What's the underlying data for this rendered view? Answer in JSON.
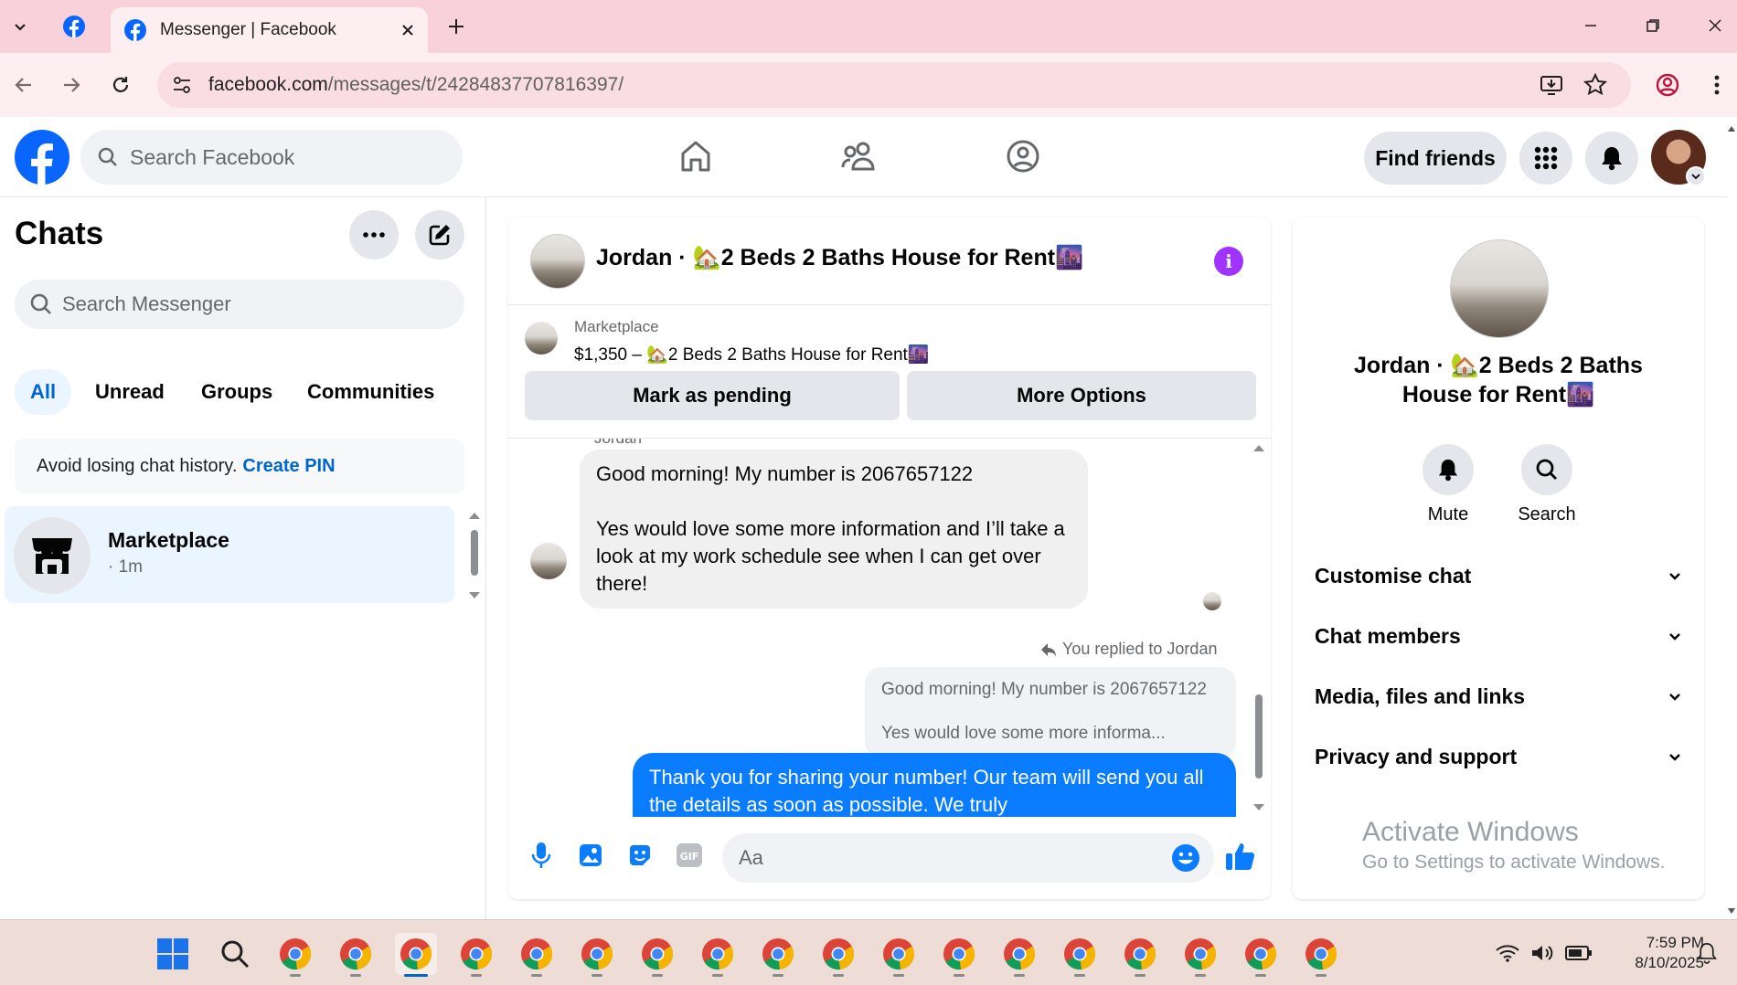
{
  "browser": {
    "tab_title": "Messenger | Facebook",
    "url_main": "facebook.com",
    "url_path": "/messages/t/24284837707816397/"
  },
  "fb_header": {
    "search_placeholder": "Search Facebook",
    "find_friends_label": "Find friends"
  },
  "left_panel": {
    "title": "Chats",
    "search_placeholder": "Search Messenger",
    "filters": [
      "All",
      "Unread",
      "Groups",
      "Communities"
    ],
    "active_filter": "All",
    "pin_notice_text": "Avoid losing chat history.",
    "pin_notice_link": "Create PIN",
    "conversations": [
      {
        "name": "Marketplace",
        "time": "· 1m"
      }
    ]
  },
  "chat": {
    "title": "Jordan · 🏡2 Beds 2 Baths House for Rent🌆",
    "marketplace_label": "Marketplace",
    "listing_line": "$1,350 – 🏡2 Beds 2 Baths House for Rent🌆",
    "mark_pending_label": "Mark as pending",
    "more_options_label": "More Options",
    "sender_name_partial": "Jordan",
    "incoming_message_line1": "Good morning! My number is 2067657122",
    "incoming_message_line2": "Yes would love some more information and I’ll take a look at my work schedule see when I can get over there!",
    "reply_notice": "You replied to Jordan",
    "quoted_line1": "Good morning! My number is 2067657122",
    "quoted_line2": "Yes would love some more informa...",
    "outgoing_message": "Thank you for sharing your number!  Our team will send you all the details as soon as possible. We truly",
    "composer_placeholder": "Aa",
    "accent_color": "#0a7cff"
  },
  "right_panel": {
    "name": "Jordan · 🏡2 Beds 2 Baths House for Rent🌆",
    "actions": [
      "Mute",
      "Search"
    ],
    "sections": [
      "Customise chat",
      "Chat members",
      "Media, files and links",
      "Privacy and support"
    ]
  },
  "watermark": {
    "title": "Activate Windows",
    "subtitle": "Go to Settings to activate Windows."
  },
  "taskbar": {
    "time": "7:59 PM",
    "date": "8/10/2025"
  }
}
